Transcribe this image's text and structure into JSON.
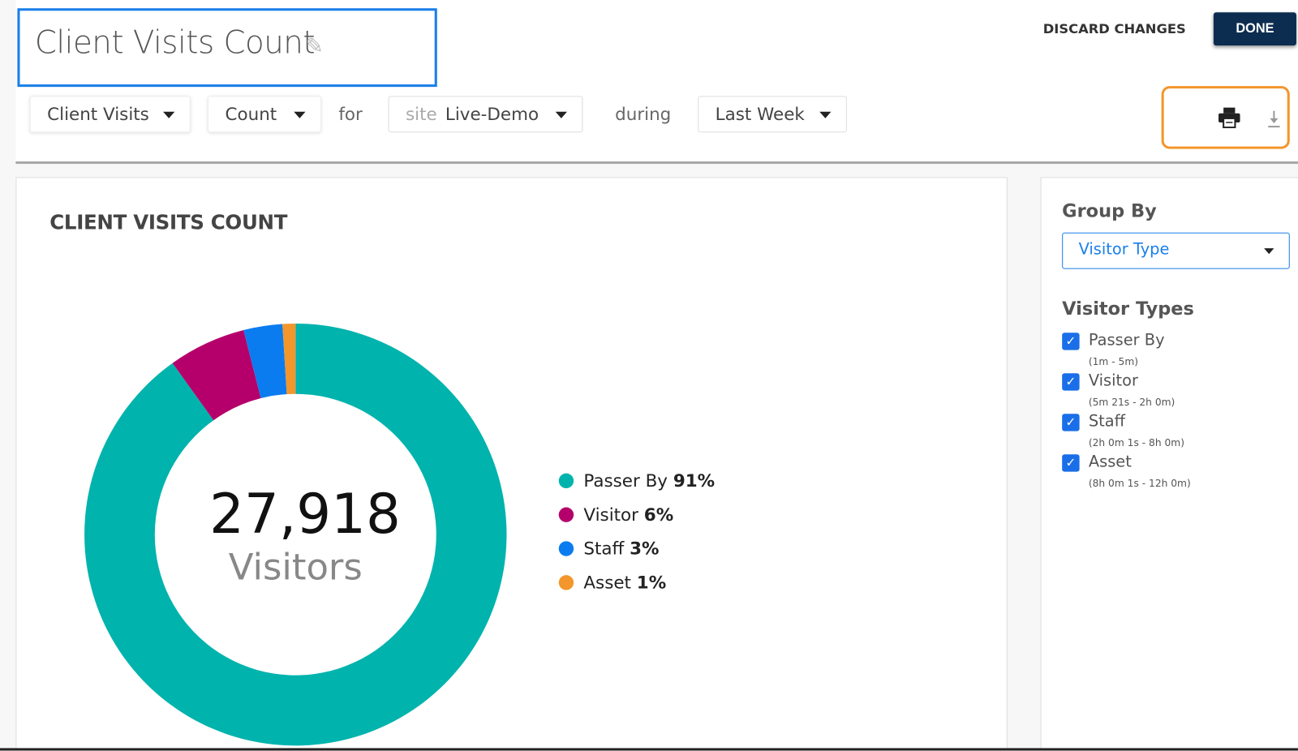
{
  "header": {
    "title": "Client Visits Count",
    "discard_label": "DISCARD CHANGES",
    "done_label": "DONE"
  },
  "filters": {
    "metric": "Client Visits",
    "measure": "Count",
    "for_word": "for",
    "site_prefix": "site",
    "site": "Live-Demo",
    "during_word": "during",
    "period": "Last Week"
  },
  "chart_data": {
    "type": "pie",
    "title": "CLIENT VISITS COUNT",
    "total": "27,918",
    "total_label": "Visitors",
    "categories": [
      "Passer By",
      "Visitor",
      "Staff",
      "Asset"
    ],
    "values": [
      91,
      6,
      3,
      1
    ],
    "value_labels": [
      "91%",
      "6%",
      "3%",
      "1%"
    ],
    "colors": [
      "#00b3ad",
      "#b5006b",
      "#0a7cf0",
      "#f3962b"
    ],
    "legend": "right"
  },
  "sidebar": {
    "group_by_label": "Group By",
    "group_by_value": "Visitor Type",
    "types_label": "Visitor Types",
    "types": [
      {
        "label": "Passer By",
        "range": "(1m - 5m)",
        "checked": true
      },
      {
        "label": "Visitor",
        "range": "(5m 21s - 2h 0m)",
        "checked": true
      },
      {
        "label": "Staff",
        "range": "(2h 0m 1s - 8h 0m)",
        "checked": true
      },
      {
        "label": "Asset",
        "range": "(8h 0m 1s - 12h 0m)",
        "checked": true
      }
    ]
  }
}
